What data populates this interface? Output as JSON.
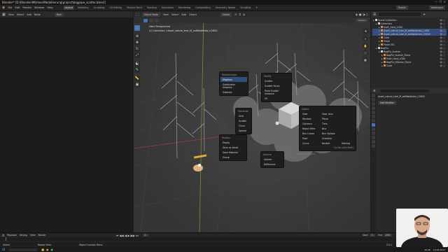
{
  "window": {
    "title": "Blender* [D:\\Blender\\Mitmen\\Modellierung\\project\\bagpipe_scatter.blend]"
  },
  "menu": {
    "items": [
      "File",
      "Edit",
      "Render",
      "Window",
      "Help"
    ],
    "workspaces": [
      "Layout",
      "Modeling",
      "Sculpting",
      "UV Editing",
      "Texture Paint",
      "Shading",
      "Animation",
      "Rendering",
      "Compositing",
      "Geometry Nodes",
      "Scripting"
    ],
    "active_workspace": "Layout",
    "scene_label": "Scene",
    "view_layer_label": "ViewLayer"
  },
  "left_editor": {
    "menu": [
      "View",
      "Select",
      "Add",
      "Node"
    ],
    "mode": "New"
  },
  "viewport": {
    "header": {
      "mode": "Object Mode",
      "menu": [
        "View",
        "Select",
        "Add",
        "Object"
      ],
      "orientation": "Global"
    },
    "overlay_title": "User Perspective",
    "overlay_subtitle": "(1) Collection | Asset_nature_tree_M_wdWaldKiste_LOD00",
    "option_label": "Options"
  },
  "pies": {
    "pie1": {
      "title": "Relationships",
      "items": [
        "Displace",
        "Subdivision Displace",
        "Subtract"
      ]
    },
    "pie2": {
      "title": "Modify",
      "items": [
        "Scatter",
        "Scatter Faces",
        "Point Scatter Instance",
        "Fit"
      ]
    },
    "pie3": {
      "title": "Generate",
      "items": [
        "Grid",
        "Scatter",
        "Circle",
        "Sphere"
      ]
    },
    "pie4": {
      "title": "Physics",
      "items": [
        "Empty",
        "Save as Asset",
        "Save Material",
        "Group"
      ]
    },
    "pie5": {
      "title": "Deform",
      "items": [
        "Sphere",
        "Difference"
      ]
    },
    "pie6": {
      "title": "Object",
      "columns": [
        [
          "Gear",
          "Window",
          "Columns",
          "Reject Wire",
          "Bun Linear",
          "Pixel",
          "Curve"
        ],
        [
          "Gear Arcs",
          "Plane",
          "Tiers",
          "Blur",
          "Blur Sphere",
          "Gradient",
          "Nested"
        ],
        [
          "",
          "",
          "",
          "",
          "",
          "",
          "Dotting"
        ]
      ],
      "footer": "Cycles (Alt+Shift)",
      "search_hint": "Shift+W to search"
    }
  },
  "outliner": {
    "search_placeholder": "",
    "title": "Scene Collection",
    "rows": [
      {
        "label": "Scene Collection",
        "indent": 0,
        "icon_color": "#cfcfcf",
        "selected": false
      },
      {
        "label": "Collection",
        "indent": 1,
        "icon_color": "#cfcfcf",
        "selected": false
      },
      {
        "label": "Kraft_Hard_LOD0",
        "indent": 2,
        "icon_color": "#e08a3c",
        "selected": false
      },
      {
        "label": "Asset_nature_tree_M_wdWaldkiste_LOD0",
        "indent": 2,
        "icon_color": "#e08a3c",
        "selected": true
      },
      {
        "label": "Asset_nature_tree_M_wdWaldkiste_LOD00",
        "indent": 2,
        "icon_color": "#e08a3c",
        "selected": true
      },
      {
        "label": "Cube",
        "indent": 2,
        "icon_color": "#e08a3c",
        "selected": false
      },
      {
        "label": "Plane",
        "indent": 2,
        "icon_color": "#e08a3c",
        "selected": false
      },
      {
        "label": "Plane.001",
        "indent": 2,
        "icon_color": "#e08a3c",
        "selected": false
      },
      {
        "label": "BagPin",
        "indent": 1,
        "icon_color": "#cfcfcf",
        "selected": false
      },
      {
        "label": "BagPin_Scatter",
        "indent": 2,
        "icon_color": "#cfcfcf",
        "selected": false
      },
      {
        "label": "BagPin_Scatter_Plane",
        "indent": 3,
        "icon_color": "#e08a3c",
        "selected": false
      },
      {
        "label": "Kraft_Hard_LOD0",
        "indent": 3,
        "icon_color": "#e08a3c",
        "selected": false
      },
      {
        "label": "BagPin_Effector_Plane",
        "indent": 3,
        "icon_color": "#e08a3c",
        "selected": false
      },
      {
        "label": "Cube",
        "indent": 3,
        "icon_color": "#e08a3c",
        "selected": false
      }
    ]
  },
  "properties": {
    "object_name": "Asset_nature_tree_M_wdWaldkiste_LOD00",
    "add_modifier": "Add Modifier"
  },
  "timeline": {
    "menu": [
      "Playback",
      "Keying",
      "View",
      "Marker"
    ],
    "start_label": "Start",
    "start": "1",
    "end_label": "End",
    "end": "250",
    "current": "1"
  },
  "status": {
    "left": "Select",
    "middle": "Rotate View",
    "right": "Object Context Menu",
    "version": "3.5.1"
  },
  "taskbar": {
    "time": "18:46",
    "date": "10.04.2023"
  },
  "colors": {
    "accent": "#4772b3",
    "selected": "#334d80",
    "object_orange": "#e08a3c"
  }
}
